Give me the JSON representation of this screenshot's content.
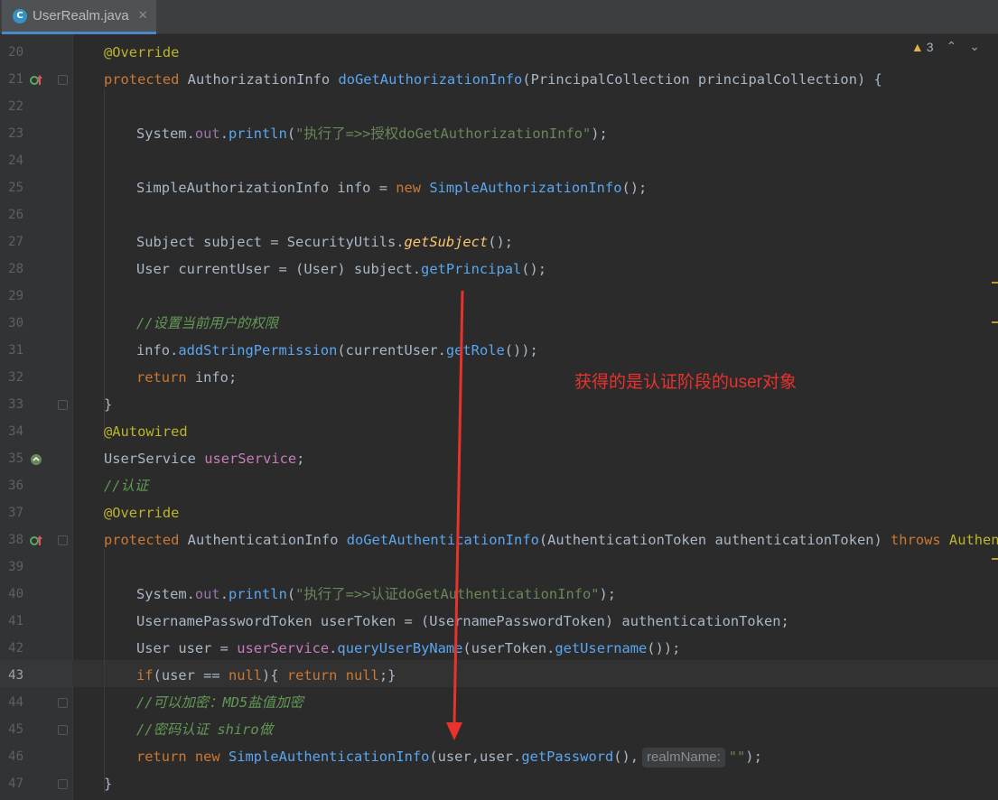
{
  "tab": {
    "icon_letter": "C",
    "title": "UserRealm.java",
    "close": "✕"
  },
  "inspection": {
    "warning_count": "3",
    "up": "⌃",
    "down": "⌄"
  },
  "annotation_note": "获得的是认证阶段的user对象",
  "colors": {
    "arrow": "#e8322c",
    "accent": "#4a88c7"
  },
  "lines": [
    {
      "n": "20",
      "html": "    <span class='ann'>@Override</span>"
    },
    {
      "n": "21",
      "html": "    <span class='kw'>protected</span> AuthorizationInfo <span class='mth'>doGetAuthorizationInfo</span>(PrincipalCollection principalCollection) {",
      "marker": "override"
    },
    {
      "n": "22",
      "html": ""
    },
    {
      "n": "23",
      "html": "        System.<span class='fld'>out</span>.<span class='mth'>println</span>(<span class='str'>\"执行了=>>授权doGetAuthorizationInfo\"</span>);"
    },
    {
      "n": "24",
      "html": ""
    },
    {
      "n": "25",
      "html": "        SimpleAuthorizationInfo info = <span class='kw'>new</span> <span class='mth'>SimpleAuthorizationInfo</span>();"
    },
    {
      "n": "26",
      "html": ""
    },
    {
      "n": "27",
      "html": "        Subject subject = SecurityUtils.<span class='sta'>getSubject</span>();"
    },
    {
      "n": "28",
      "html": "        User currentUser = (User) subject.<span class='mth'>getPrincipal</span>();"
    },
    {
      "n": "29",
      "html": ""
    },
    {
      "n": "30",
      "html": "        <span class='cmt'>//设置当前用户的权限</span>"
    },
    {
      "n": "31",
      "html": "        info.<span class='mth'>addStringPermission</span>(currentUser.<span class='mth'>getRole</span>());"
    },
    {
      "n": "32",
      "html": "        <span class='kw'>return</span> info;"
    },
    {
      "n": "33",
      "html": "    }"
    },
    {
      "n": "34",
      "html": "    <span class='ann'>@Autowired</span>"
    },
    {
      "n": "35",
      "html": "    UserService <span class='var'>userService</span>;",
      "marker": "bean"
    },
    {
      "n": "36",
      "html": "    <span class='cmt'>//认证</span>"
    },
    {
      "n": "37",
      "html": "    <span class='ann'>@Override</span>"
    },
    {
      "n": "38",
      "html": "    <span class='kw'>protected</span> AuthenticationInfo <span class='mth'>doGetAuthenticationInfo</span>(AuthenticationToken authenticationToken) <span class='kw'>throws</span> <span class='ann'>Authentic</span>",
      "marker": "override"
    },
    {
      "n": "39",
      "html": ""
    },
    {
      "n": "40",
      "html": "        System.<span class='fld'>out</span>.<span class='mth'>println</span>(<span class='str'>\"执行了=>>认证doGetAuthenticationInfo\"</span>);"
    },
    {
      "n": "41",
      "html": "        UsernamePasswordToken userToken = (UsernamePasswordToken) authenticationToken;"
    },
    {
      "n": "42",
      "html": "        User user = <span class='var'>userService</span>.<span class='mth'>queryUserByName</span>(userToken.<span class='mth'>getUsername</span>());"
    },
    {
      "n": "43",
      "html": "        <span class='kw'>if</span>(user == <span class='kw'>null</span>){ <span class='kw'>return</span> <span class='kw'>null</span>;}",
      "current": true
    },
    {
      "n": "44",
      "html": "        <span class='cmt'>//可以加密：MD5盐值加密</span>"
    },
    {
      "n": "45",
      "html": "        <span class='cmt'>//密码认证 shiro做</span>"
    },
    {
      "n": "46",
      "html": "        <span class='kw'>return</span> <span class='kw'>new</span> <span class='mth'>SimpleAuthenticationInfo</span>(user,user.<span class='mth'>getPassword</span>(),<span class='hint'>realmName:</span><span class='str'>\"\"</span>);"
    },
    {
      "n": "47",
      "html": "    }"
    }
  ]
}
